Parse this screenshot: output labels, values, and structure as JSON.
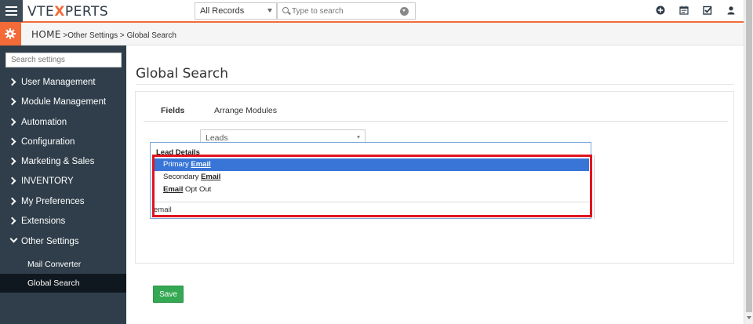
{
  "app": {
    "logo_prefix": "VTE",
    "logo_x": "X",
    "logo_suffix": "PERTS",
    "records_filter": "All Records",
    "search_placeholder": "Type to search"
  },
  "header_icons": [
    "plus-circle-icon",
    "calendar-icon",
    "checkbox-icon",
    "user-icon"
  ],
  "breadcrumb": {
    "home": "HOME",
    "sep1": " >",
    "level1": "Other Settings",
    "sep2": " > ",
    "level2": "Global Search"
  },
  "sidebar": {
    "search_placeholder": "Search settings",
    "items": [
      {
        "label": "User Management"
      },
      {
        "label": "Module Management"
      },
      {
        "label": "Automation"
      },
      {
        "label": "Configuration"
      },
      {
        "label": "Marketing & Sales"
      },
      {
        "label": "INVENTORY"
      },
      {
        "label": "My Preferences"
      },
      {
        "label": "Extensions"
      },
      {
        "label": "Other Settings"
      }
    ],
    "sub_items": [
      {
        "label": "Mail Converter"
      },
      {
        "label": "Global Search"
      }
    ]
  },
  "main": {
    "title": "Global Search",
    "tabs": [
      {
        "label": "Fields"
      },
      {
        "label": "Arrange Modules"
      }
    ],
    "module_select": "Leads",
    "dropdown": {
      "group": "Lead Details",
      "options": [
        {
          "pre": "Primary ",
          "match": "Email",
          "post": ""
        },
        {
          "pre": "Secondary ",
          "match": "Email",
          "post": ""
        },
        {
          "pre": "",
          "match": "Email",
          "post": " Opt Out"
        }
      ],
      "filter_text": "email"
    },
    "save_label": "Save"
  },
  "colors": {
    "accent": "#f26b39",
    "sidebar_bg": "#2f3e4a",
    "selected_option": "#3875d7",
    "save_button": "#35a853",
    "highlight": "#e0141e"
  }
}
